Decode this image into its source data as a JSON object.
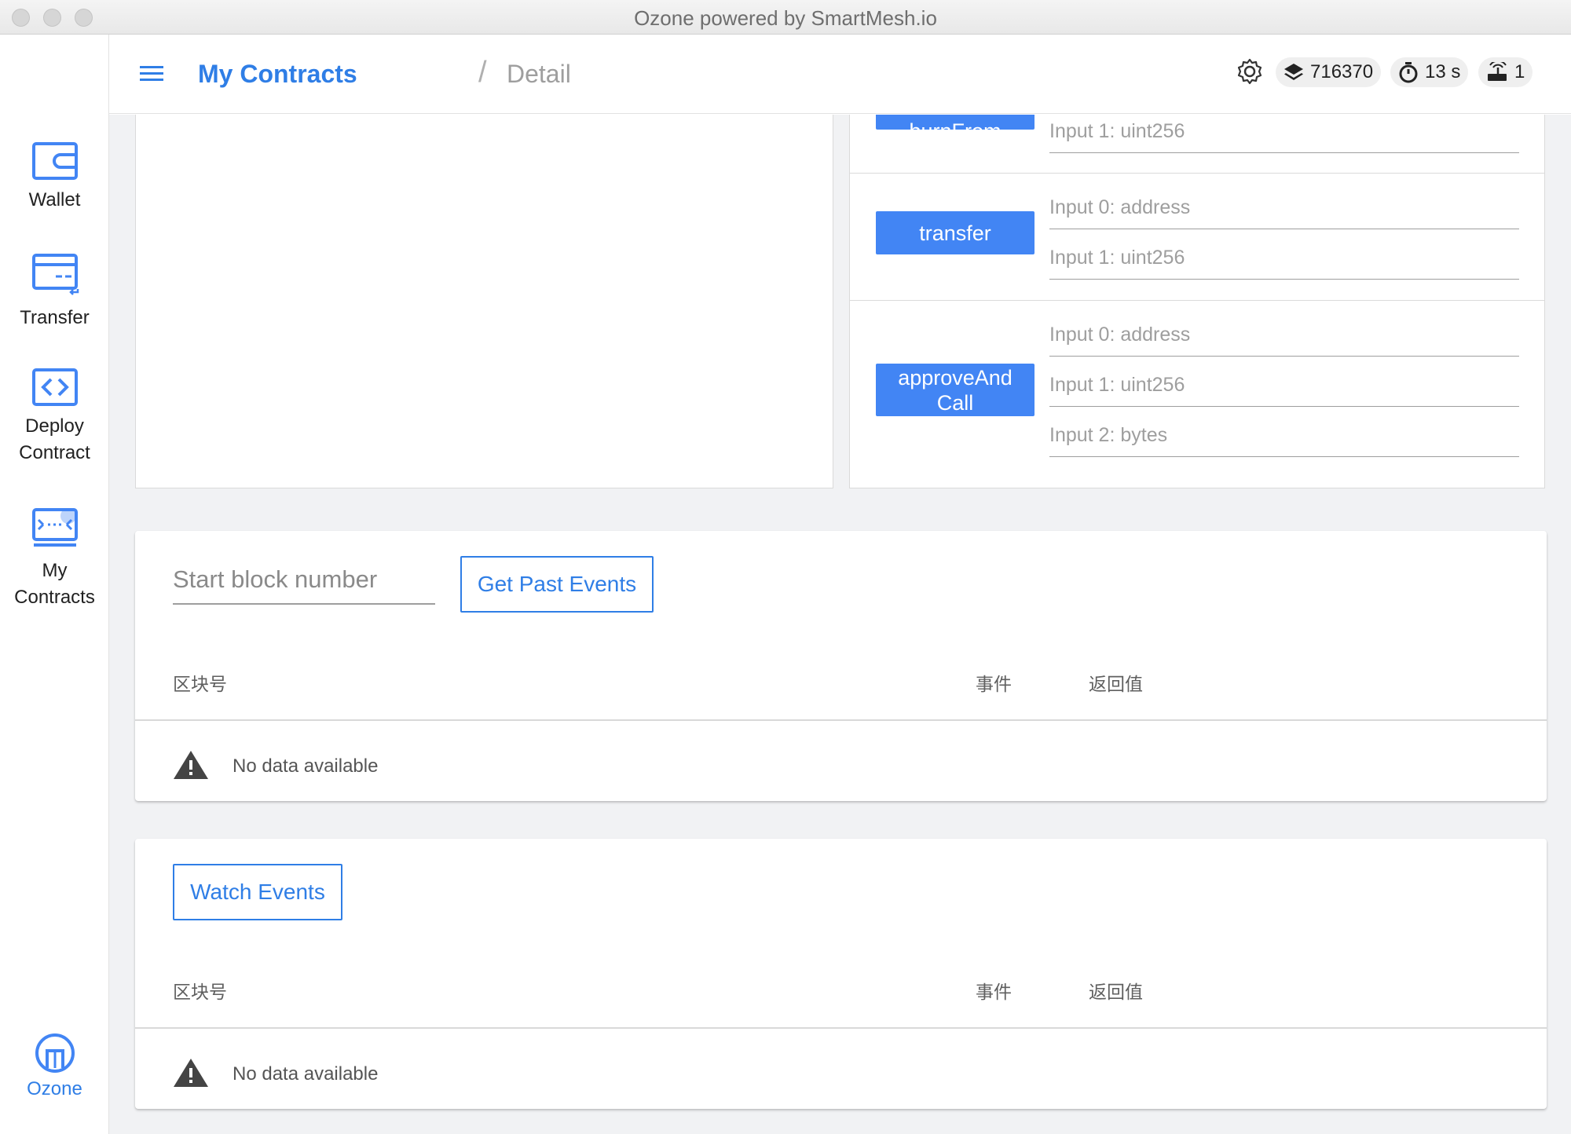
{
  "window": {
    "title": "Ozone powered by SmartMesh.io"
  },
  "sidebar": {
    "items": [
      {
        "label": "Wallet",
        "icon": "wallet-icon"
      },
      {
        "label": "Transfer",
        "icon": "transfer-card-icon"
      },
      {
        "label": "Deploy\nContract",
        "icon": "code-brackets-icon"
      },
      {
        "label": "My\nContracts",
        "icon": "contracts-icon"
      }
    ],
    "brand": {
      "label": "Ozone",
      "icon": "ozone-logo-icon"
    }
  },
  "header": {
    "breadcrumb": {
      "parent": "My Contracts",
      "separator": "/",
      "current": "Detail"
    },
    "status": {
      "block_number": "716370",
      "block_time": "13 s",
      "peers": "1"
    }
  },
  "functions": [
    {
      "name": "burnFrom",
      "inputs": [
        "Input 1: uint256"
      ]
    },
    {
      "name": "transfer",
      "inputs": [
        "Input 0: address",
        "Input 1: uint256"
      ]
    },
    {
      "name": "approveAnd\nCall",
      "inputs": [
        "Input 0: address",
        "Input 1: uint256",
        "Input 2: bytes"
      ]
    }
  ],
  "past_events": {
    "start_placeholder": "Start block number",
    "button": "Get Past Events",
    "columns": [
      "区块号",
      "事件",
      "返回值"
    ],
    "empty_text": "No data available"
  },
  "watch_events": {
    "button": "Watch Events",
    "columns": [
      "区块号",
      "事件",
      "返回值"
    ],
    "empty_text": "No data available"
  },
  "colors": {
    "accent": "#2f7ee6",
    "button_fill": "#4285f4",
    "content_bg": "#f1f2f4"
  }
}
